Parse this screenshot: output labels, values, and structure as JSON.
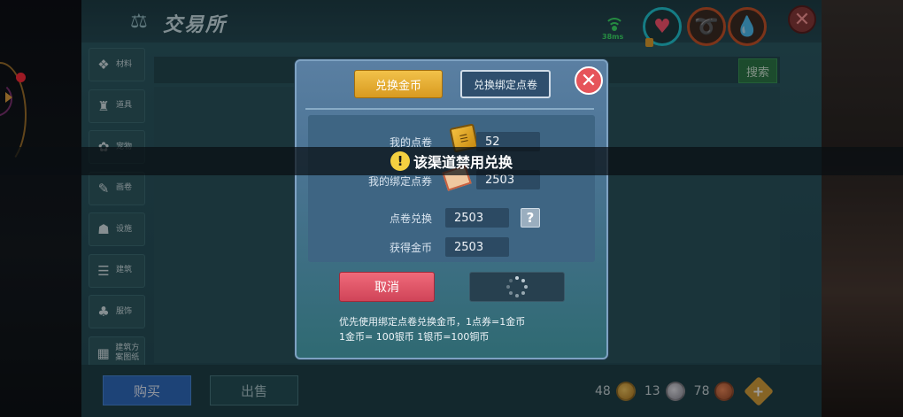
{
  "window": {
    "title": "交易所",
    "ping": "38ms"
  },
  "icons": {
    "scale": "balance-scale-icon",
    "heart": "heart-icon",
    "hunger": "hunger-icon",
    "water": "water-drop-icon",
    "close": "close-icon",
    "signal": "wifi-signal-icon"
  },
  "sidebar": {
    "items": [
      {
        "label": "材料",
        "icon": "material-icon",
        "glyph": "❖"
      },
      {
        "label": "道具",
        "icon": "tool-icon",
        "glyph": "♜"
      },
      {
        "label": "宠物",
        "icon": "pet-paw-icon",
        "glyph": "✿"
      },
      {
        "label": "画卷",
        "icon": "scroll-icon",
        "glyph": "✎"
      },
      {
        "label": "设施",
        "icon": "facility-icon",
        "glyph": "☗"
      },
      {
        "label": "建筑",
        "icon": "building-icon",
        "glyph": "☰"
      },
      {
        "label": "服饰",
        "icon": "clothing-icon",
        "glyph": "♣"
      },
      {
        "label": "建筑方案图纸",
        "icon": "blueprint-icon",
        "glyph": "▦"
      }
    ]
  },
  "search": {
    "button_label": "搜索"
  },
  "bottom": {
    "buy_label": "购买",
    "sell_label": "出售",
    "gold": "48",
    "silver": "13",
    "copper": "78"
  },
  "dialog": {
    "tab_exchange_coins": "兑换金币",
    "tab_exchange_bound": "兑换绑定点卷",
    "my_points_label": "我的点卷",
    "my_points_value": "52",
    "bound_points_label": "我的绑定点券",
    "bound_points_value": "2503",
    "exchange_label": "点卷兑换",
    "exchange_value": "2503",
    "gain_label": "获得金币",
    "gain_value": "2503",
    "cancel_label": "取消",
    "note_line1": "优先使用绑定点卷兑换金币，1点券=1金币",
    "note_line2": "1金币= 100银币  1银币=100铜币"
  },
  "toast": {
    "message": "该渠道禁用兑换"
  },
  "colors": {
    "accent_gold": "#d89a20",
    "cancel_red": "#d04458",
    "buy_blue": "#2f6cc0"
  }
}
